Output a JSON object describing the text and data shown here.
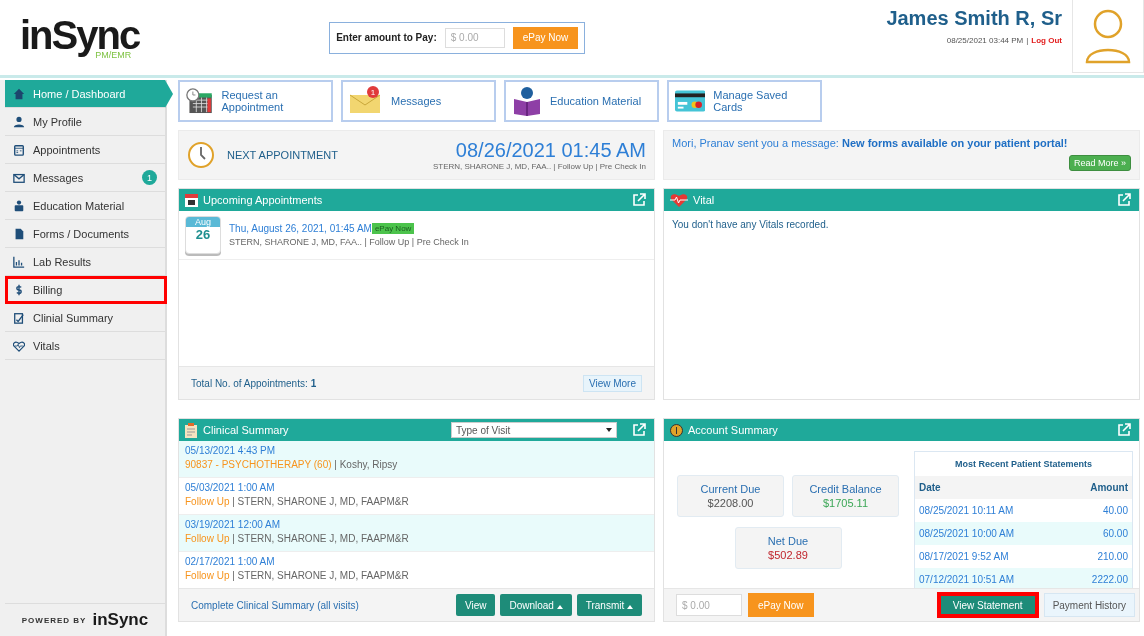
{
  "logo": {
    "name": "inSync",
    "sub": "PM/EMR"
  },
  "pay_bar": {
    "label": "Enter amount to Pay:",
    "placeholder": "$ 0.00",
    "button": "ePay Now"
  },
  "user": {
    "name": "James Smith R, Sr",
    "datetime": "08/25/2021 03:44 PM",
    "separator": "|",
    "logout": "Log Out"
  },
  "sidebar": {
    "items": [
      {
        "label": "Home / Dashboard",
        "selected": true,
        "highlighted": false
      },
      {
        "label": "My Profile",
        "selected": false,
        "highlighted": false
      },
      {
        "label": "Appointments",
        "selected": false,
        "highlighted": false
      },
      {
        "label": "Messages",
        "selected": false,
        "highlighted": false,
        "badge": "1"
      },
      {
        "label": "Education Material",
        "selected": false,
        "highlighted": false
      },
      {
        "label": "Forms / Documents",
        "selected": false,
        "highlighted": false
      },
      {
        "label": "Lab Results",
        "selected": false,
        "highlighted": false
      },
      {
        "label": "Billing",
        "selected": false,
        "highlighted": true
      },
      {
        "label": "Clinial Summary",
        "selected": false,
        "highlighted": false
      },
      {
        "label": "Vitals",
        "selected": false,
        "highlighted": false
      }
    ],
    "powered_by": "POWERED BY",
    "powered_logo": "inSync"
  },
  "tiles": [
    {
      "label": "Request an Appointment"
    },
    {
      "label": "Messages",
      "badge": "1"
    },
    {
      "label": "Education Material"
    },
    {
      "label": "Manage Saved Cards"
    }
  ],
  "next_appointment": {
    "label": "NEXT APPOINTMENT",
    "datetime": "08/26/2021 01:45 AM",
    "detail": "STERN, SHARONE J, MD, FAA.. | Follow Up | Pre Check In"
  },
  "message_banner": {
    "text": "Mori, Pranav sent you a message: **New forms available on your patient portal!**",
    "button": "Read More »"
  },
  "upcoming": {
    "title": "Upcoming Appointments",
    "items": [
      {
        "month": "Aug",
        "day": "26",
        "datetime": "Thu, August 26, 2021, 01:45 AM",
        "tag": "ePay Now",
        "detail": "STERN, SHARONE J, MD, FAA.. | Follow Up | Pre Check In"
      }
    ],
    "total_label": "Total No. of Appointments:",
    "total": "1",
    "button": "View More"
  },
  "vital": {
    "title": "Vital",
    "empty": "You don't have any Vitals recorded."
  },
  "clinical": {
    "title": "Clinical Summary",
    "filter": "Type of Visit",
    "rows": [
      {
        "datetime": "05/13/2021 4:43 PM",
        "visit": "90837 - PSYCHOTHERAPY (60)",
        "provider": " | Koshy, Ripsy"
      },
      {
        "datetime": "05/03/2021 1:00 AM",
        "visit": "Follow Up",
        "provider": " | STERN, SHARONE J, MD, FAAPM&R"
      },
      {
        "datetime": "03/19/2021 12:00 AM",
        "visit": "Follow Up",
        "provider": " | STERN, SHARONE J, MD, FAAPM&R"
      },
      {
        "datetime": "02/17/2021 1:00 AM",
        "visit": "Follow Up",
        "provider": " | STERN, SHARONE J, MD, FAAPM&R"
      }
    ],
    "link": "Complete Clinical Summary (all visits)",
    "buttons": [
      {
        "label": "View",
        "caret": false
      },
      {
        "label": "Download",
        "caret": true
      },
      {
        "label": "Transmit",
        "caret": true
      }
    ]
  },
  "account": {
    "title": "Account Summary",
    "boxes": [
      {
        "label": "Current Due",
        "value": "$2208.00",
        "color": "#555555"
      },
      {
        "label": "Credit Balance",
        "value": "$1705.11",
        "color": "#3aa655"
      },
      {
        "label": "Net Due",
        "value": "$502.89",
        "color": "#c0262d"
      }
    ],
    "statements": {
      "title": "Most Recent Patient Statements",
      "columns": [
        "Date",
        "Amount"
      ],
      "rows": [
        [
          "08/25/2021 10:11 AM",
          "40.00"
        ],
        [
          "08/25/2021 10:00 AM",
          "60.00"
        ],
        [
          "08/17/2021 9:52 AM",
          "210.00"
        ],
        [
          "07/12/2021 10:51 AM",
          "2222.00"
        ]
      ]
    },
    "pay_placeholder": "$ 0.00",
    "pay_button": "ePay Now",
    "buttons": [
      {
        "label": "View Statement",
        "primary": true,
        "highlighted": true
      },
      {
        "label": "Payment History",
        "primary": false,
        "highlighted": false
      }
    ]
  }
}
